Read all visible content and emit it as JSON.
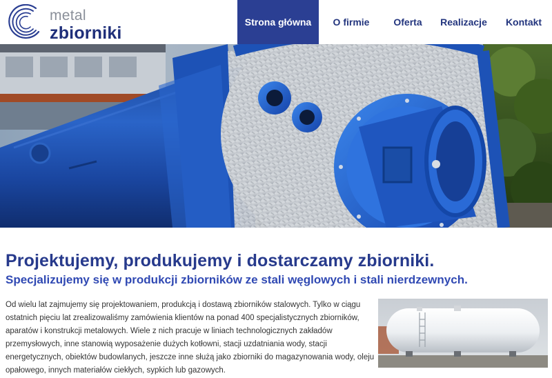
{
  "brand": {
    "line1": "metal",
    "line2": "zbiorniki"
  },
  "nav": {
    "items": [
      {
        "label": "Strona główna",
        "active": true
      },
      {
        "label": "O firmie",
        "active": false
      },
      {
        "label": "Oferta",
        "active": false
      },
      {
        "label": "Realizacje",
        "active": false
      },
      {
        "label": "Kontakt",
        "active": false
      }
    ]
  },
  "main": {
    "headline": "Projektujemy, produkujemy i dostarczamy zbiorniki.",
    "subheadline": "Specjalizujemy się w produkcji zbiorników ze stali węglowych i stali nierdzewnych.",
    "paragraph_lines": [
      "Od wielu lat zajmujemy się projektowaniem, produkcją i dostawą zbiorników stalowych. Tylko w ciągu",
      "ostatnich pięciu lat zrealizowaliśmy zamówienia klientów na ponad 400 specjalistycznych zbiorników,",
      "aparatów i konstrukcji metalowych. Wiele z nich pracuje w liniach technologicznych zakładów",
      "przemysłowych, inne stanowią wyposażenie dużych kotłowni, stacji uzdatniania wody, stacji",
      "energetycznych, obiektów budowlanych, jeszcze inne służą jako zbiorniki do magazynowania wody, oleju",
      "opałowego, innych materiałów ciekłych, sypkich lub gazowych."
    ]
  },
  "colors": {
    "brand_navy": "#273a8c",
    "nav_active_bg": "#2b3f93",
    "tank_blue": "#1f5fc8"
  },
  "icons": {
    "logo": "concentric-arcs-logo-icon"
  }
}
